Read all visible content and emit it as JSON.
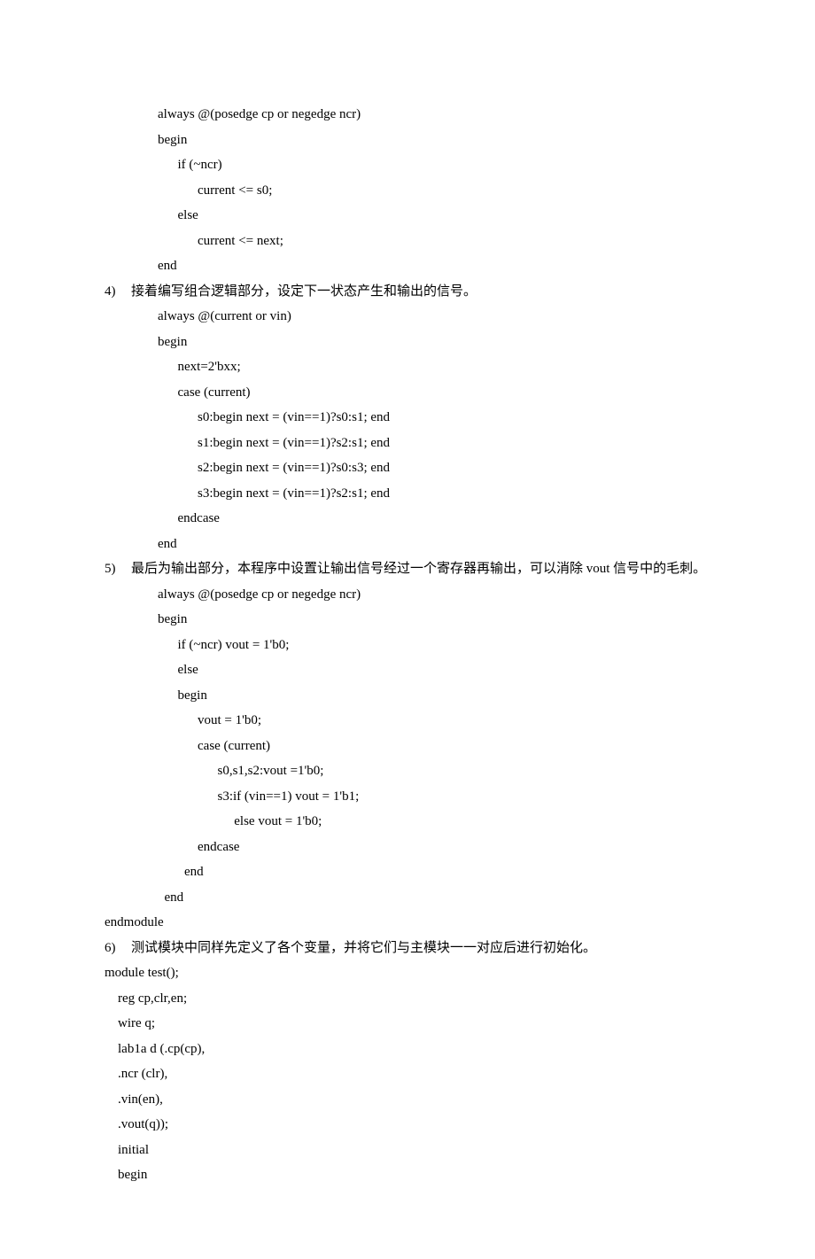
{
  "lines": {
    "l01": "        always @(posedge cp or negedge ncr)",
    "l02": "        begin",
    "l03": "              if (~ncr)",
    "l04": "                    current <= s0;",
    "l05": "              else",
    "l06": "                    current <= next;",
    "l07": "        end",
    "l09": "        always @(current or vin)",
    "l10": "        begin",
    "l11": "              next=2'bxx;",
    "l12": "              case (current)",
    "l13": "                    s0:begin next = (vin==1)?s0:s1; end",
    "l14": "                    s1:begin next = (vin==1)?s2:s1; end",
    "l15": "                    s2:begin next = (vin==1)?s0:s3; end",
    "l16": "                    s3:begin next = (vin==1)?s2:s1; end",
    "l17": "              endcase",
    "l18": "        end",
    "l21": "        always @(posedge cp or negedge ncr)",
    "l22": "        begin",
    "l23": "              if (~ncr) vout = 1'b0;",
    "l24": "              else",
    "l25": "              begin",
    "l26": "                    vout = 1'b0;",
    "l27": "                    case (current)",
    "l28": "                          s0,s1,s2:vout =1'b0;",
    "l29": "                          s3:if (vin==1) vout = 1'b1;",
    "l30": "                               else vout = 1'b0;",
    "l31": "                    endcase",
    "l32": "                end",
    "l33": "          end",
    "l34": "endmodule",
    "l36": "module test();",
    "l37": "    reg cp,clr,en;",
    "l38": "    wire q;",
    "l39": "    lab1a d (.cp(cp),",
    "l40": "    .ncr (clr),",
    "l41": "    .vin(en),",
    "l42": "    .vout(q));",
    "l43": "    initial",
    "l44": "    begin"
  },
  "items": {
    "n4_num": "4)",
    "n4_txt": "接着编写组合逻辑部分，设定下一状态产生和输出的信号。",
    "n5_num": "5)",
    "n5_txt": "最后为输出部分，本程序中设置让输出信号经过一个寄存器再输出，可以消除 vout 信号中的毛刺。",
    "n6_num": "6)",
    "n6_txt": "测试模块中同样先定义了各个变量，并将它们与主模块一一对应后进行初始化。"
  }
}
